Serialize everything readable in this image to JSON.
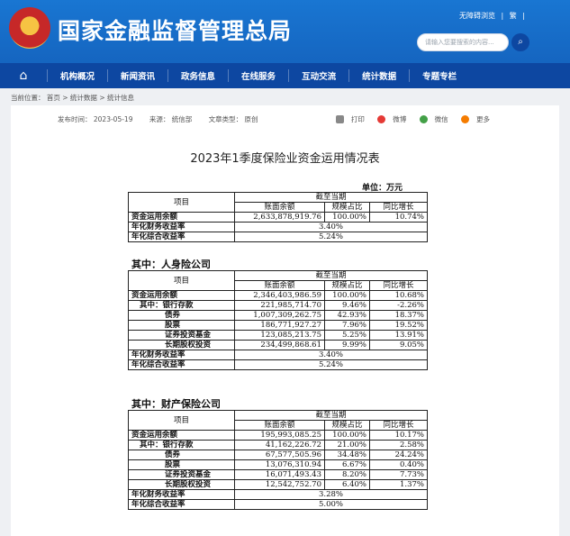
{
  "header": {
    "site_title": "国家金融监督管理总局",
    "links": [
      "无障碍浏览",
      "|",
      "繁",
      "|"
    ],
    "search_placeholder": "请输入您要搜索的内容...",
    "search_icon": "search-icon",
    "emblem_icon": "national-emblem-icon",
    "brand_color": "#1565c0"
  },
  "nav": {
    "home_icon": "home-icon",
    "items": [
      "机构概况",
      "新闻资讯",
      "政务信息",
      "在线服务",
      "互动交流",
      "统计数据",
      "专题专栏"
    ]
  },
  "breadcrumb": "当前位置： 首页 > 统计数据 > 统计信息",
  "meta": {
    "publish_time": "发布时间： 2023-05-19",
    "source": "来源： 统信部",
    "doc_type": "文章类型： 原创"
  },
  "share": {
    "print": "打印",
    "weibo": "微博",
    "wechat": "微信",
    "more": "更多"
  },
  "doc_title": "2023年1季度保险业资金运用情况表",
  "unit": "单位：万元",
  "table_header": {
    "item": "项目",
    "as_of": "截至当期",
    "balance": "账面余额",
    "share": "规模占比",
    "yoy": "同比增长"
  },
  "total": {
    "rows": [
      {
        "label": "资金运用余额",
        "balance": "2,633,878,919.76",
        "share": "100.00%",
        "yoy": "10.74%"
      }
    ],
    "financial_yield_label": "年化财务收益率",
    "financial_yield": "3.40%",
    "comprehensive_yield_label": "年化综合收益率",
    "comprehensive_yield": "5.24%"
  },
  "life": {
    "section_title": "其中：人身险公司",
    "rows": [
      {
        "label": "资金运用余额",
        "balance": "2,346,403,986.59",
        "share": "100.00%",
        "yoy": "10.68%"
      },
      {
        "label": "其中：银行存款",
        "balance": "221,985,714.70",
        "share": "9.46%",
        "yoy": "-2.26%"
      },
      {
        "label": "债券",
        "balance": "1,007,309,262.75",
        "share": "42.93%",
        "yoy": "18.37%"
      },
      {
        "label": "股票",
        "balance": "186,771,927.27",
        "share": "7.96%",
        "yoy": "19.52%"
      },
      {
        "label": "证券投资基金",
        "balance": "123,085,213.75",
        "share": "5.25%",
        "yoy": "13.91%"
      },
      {
        "label": "长期股权投资",
        "balance": "234,499,868.61",
        "share": "9.99%",
        "yoy": "9.05%"
      }
    ],
    "financial_yield_label": "年化财务收益率",
    "financial_yield": "3.40%",
    "comprehensive_yield_label": "年化综合收益率",
    "comprehensive_yield": "5.24%"
  },
  "property": {
    "section_title": "其中：财产保险公司",
    "rows": [
      {
        "label": "资金运用余额",
        "balance": "195,993,085.25",
        "share": "100.00%",
        "yoy": "10.17%"
      },
      {
        "label": "其中：银行存款",
        "balance": "41,162,226.72",
        "share": "21.00%",
        "yoy": "2.58%"
      },
      {
        "label": "债券",
        "balance": "67,577,505.96",
        "share": "34.48%",
        "yoy": "24.24%"
      },
      {
        "label": "股票",
        "balance": "13,076,310.94",
        "share": "6.67%",
        "yoy": "0.40%"
      },
      {
        "label": "证券投资基金",
        "balance": "16,071,493.43",
        "share": "8.20%",
        "yoy": "7.73%"
      },
      {
        "label": "长期股权投资",
        "balance": "12,542,752.70",
        "share": "6.40%",
        "yoy": "1.37%"
      }
    ],
    "financial_yield_label": "年化财务收益率",
    "financial_yield": "3.28%",
    "comprehensive_yield_label": "年化综合收益率",
    "comprehensive_yield": "5.00%"
  }
}
